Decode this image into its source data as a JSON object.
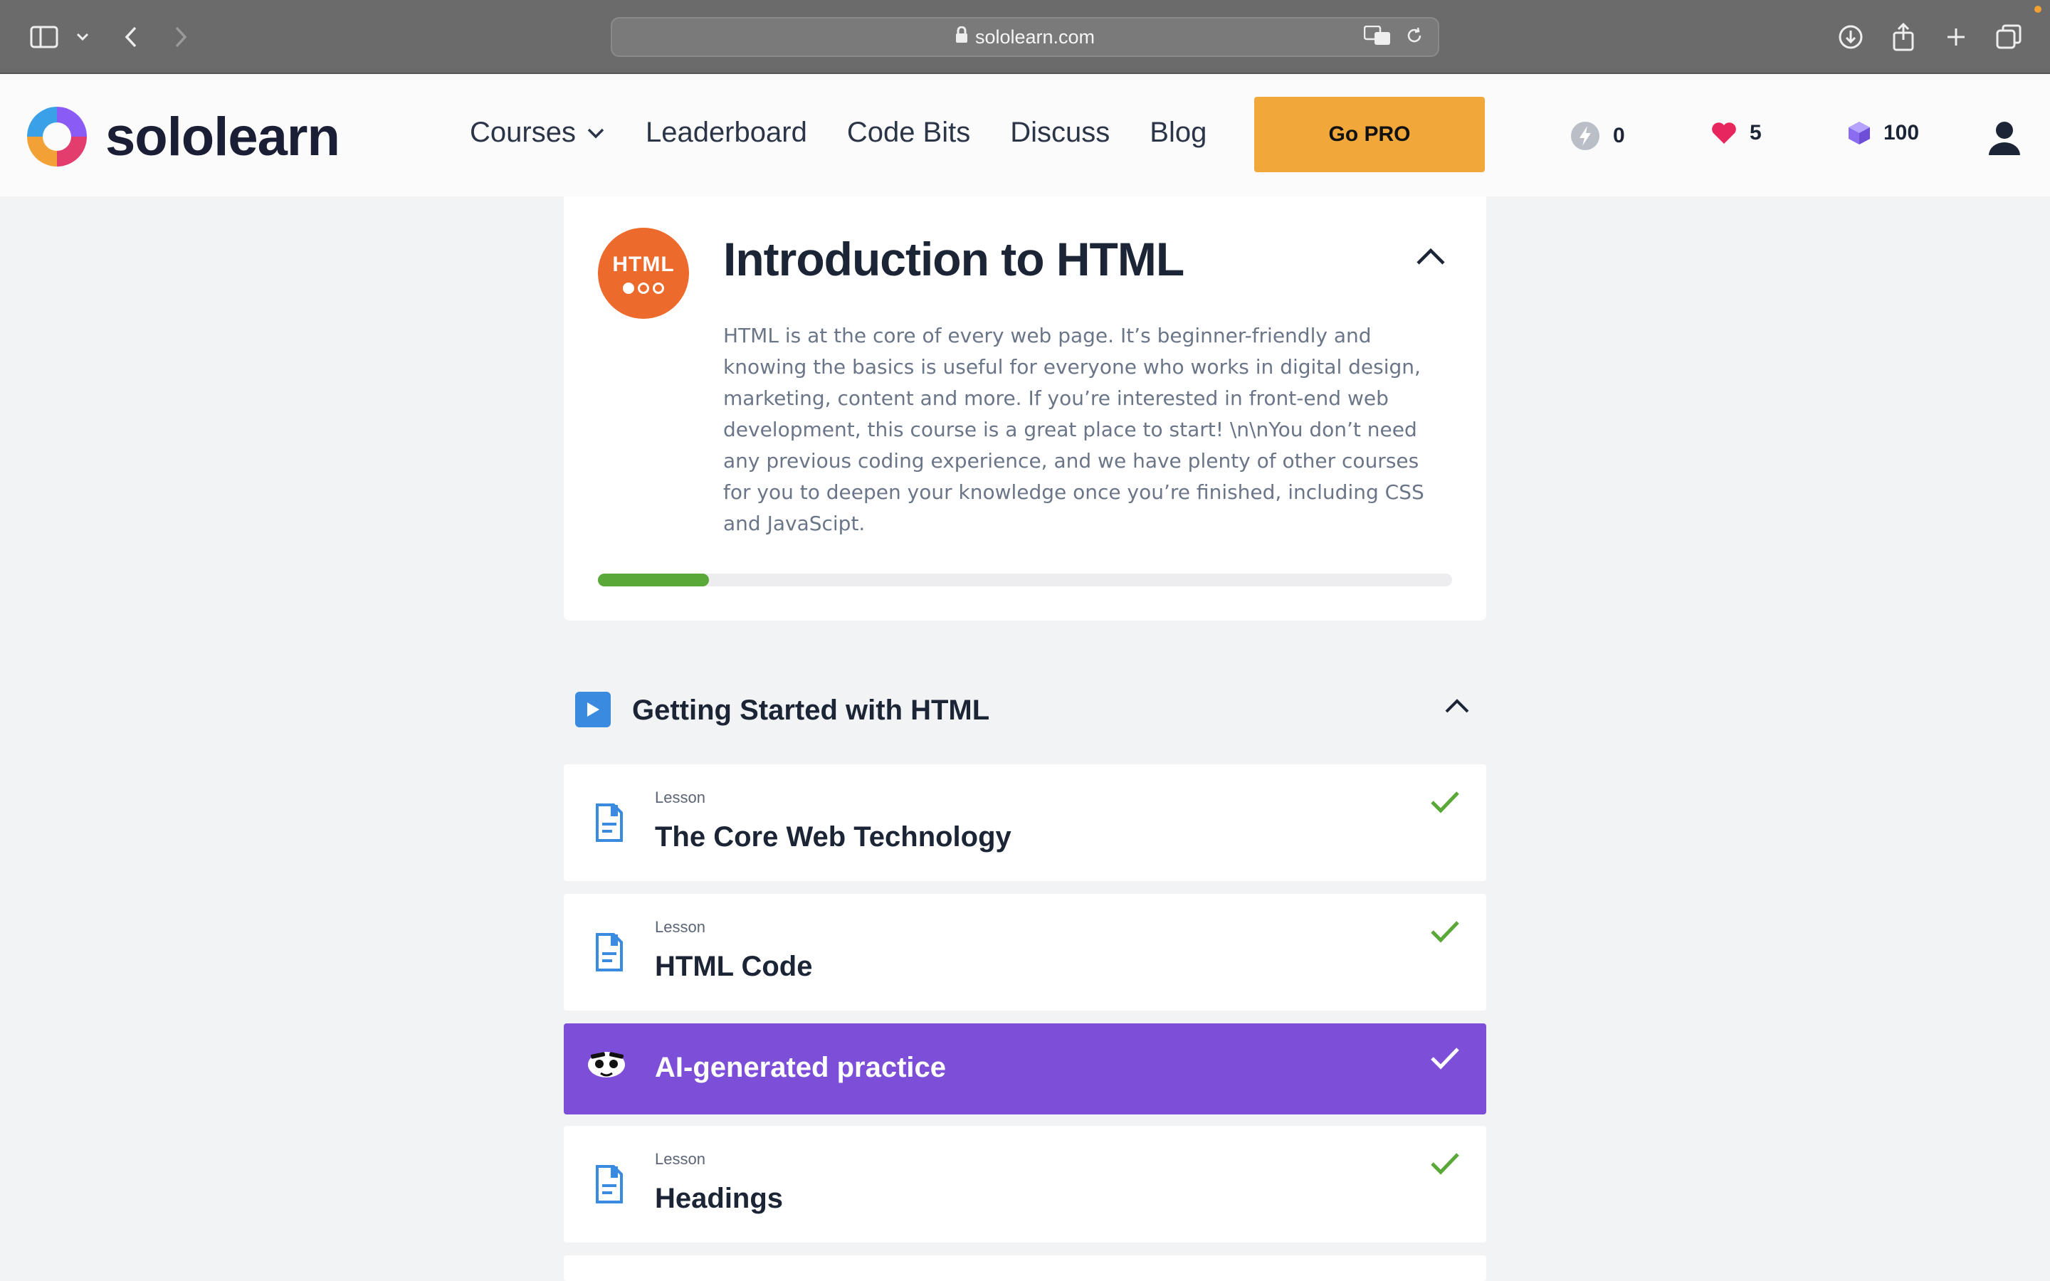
{
  "browser": {
    "url": "sololearn.com"
  },
  "header": {
    "logo_text": "sololearn",
    "nav": [
      {
        "label": "Courses"
      },
      {
        "label": "Leaderboard"
      },
      {
        "label": "Code Bits"
      },
      {
        "label": "Discuss"
      },
      {
        "label": "Blog"
      }
    ],
    "gopro_label": "Go PRO",
    "stats": {
      "streak": "0",
      "hearts": "5",
      "gems": "100"
    }
  },
  "course": {
    "badge_text": "HTML",
    "title": "Introduction to HTML",
    "description": "HTML is at the core of every web page. It’s beginner-friendly and knowing the basics is useful for everyone who works in digital design, marketing, content and more. If you’re interested in front-end web development, this course is a great place to start! \\n\\nYou don’t need any previous coding experience, and we have plenty of other courses for you to deepen your knowledge once you’re finished, including CSS and JavaScipt.",
    "progress_fraction": 0.13
  },
  "section": {
    "title": "Getting Started with HTML"
  },
  "lessons": [
    {
      "kind": "Lesson",
      "title": "The Core Web Technology",
      "completed": true
    },
    {
      "kind": "Lesson",
      "title": "HTML Code",
      "completed": true
    },
    {
      "kind": "",
      "title": "AI-generated practice",
      "completed": true
    },
    {
      "kind": "Lesson",
      "title": "Headings",
      "completed": true
    }
  ],
  "colors": {
    "accent_pro": "#f1a73a",
    "course_badge": "#ec6a2c",
    "ai_practice_bg": "#7d4fd9",
    "progress": "#5aa838",
    "check": "#5aa838"
  }
}
